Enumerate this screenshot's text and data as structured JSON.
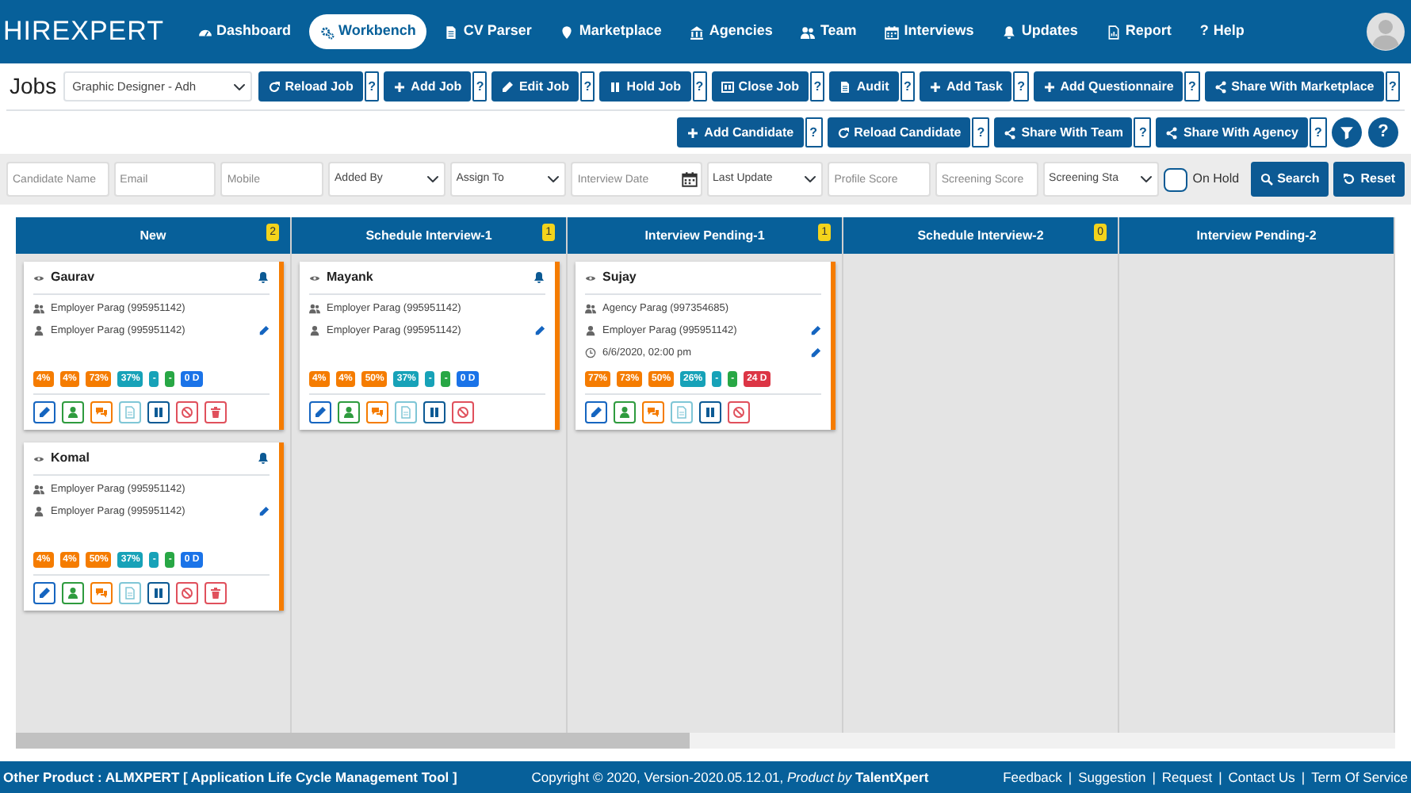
{
  "logo": "HIREXPERT",
  "nav": [
    {
      "label": "Dashboard",
      "kind": "gauge",
      "selected": false
    },
    {
      "label": "Workbench",
      "kind": "gear",
      "selected": true
    },
    {
      "label": "CV Parser",
      "kind": "document",
      "selected": false
    },
    {
      "label": "Marketplace",
      "kind": "pin",
      "selected": false
    },
    {
      "label": "Agencies",
      "kind": "bank",
      "selected": false
    },
    {
      "label": "Team",
      "kind": "users",
      "selected": false
    },
    {
      "label": "Interviews",
      "kind": "calendar",
      "selected": false
    },
    {
      "label": "Updates",
      "kind": "bell",
      "selected": false
    },
    {
      "label": "Report",
      "kind": "report",
      "selected": false
    },
    {
      "label": "Help",
      "kind": "help",
      "glyph": "?",
      "selected": false
    }
  ],
  "page_title": "Jobs",
  "job_select": {
    "value": "Graphic Designer - Adh"
  },
  "job_actions": [
    {
      "label": "Reload Job",
      "kind": "refresh",
      "help": "?"
    },
    {
      "label": "Add Job",
      "kind": "plus",
      "help": "?"
    },
    {
      "label": "Edit Job",
      "kind": "pencil",
      "help": "?"
    },
    {
      "label": "Hold Job",
      "kind": "pause",
      "help": "?"
    },
    {
      "label": "Close Job",
      "kind": "columns",
      "help": "?"
    },
    {
      "label": "Audit",
      "kind": "document",
      "help": "?"
    },
    {
      "label": "Add Task",
      "kind": "plus",
      "help": "?"
    },
    {
      "label": "Add Questionnaire",
      "kind": "plus",
      "help": "?"
    },
    {
      "label": "Share With Marketplace",
      "kind": "share",
      "help": "?"
    }
  ],
  "candidate_actions": [
    {
      "label": "Add Candidate",
      "kind": "plus",
      "help": "?"
    },
    {
      "label": "Reload Candidate",
      "kind": "refresh",
      "help": "?"
    },
    {
      "label": "Share With Team",
      "kind": "share",
      "help": "?"
    },
    {
      "label": "Share With Agency",
      "kind": "share",
      "help": "?"
    }
  ],
  "round_buttons": [
    {
      "kind": "filter"
    },
    {
      "kind": "help",
      "glyph": "?"
    }
  ],
  "filters": [
    {
      "kind": "text",
      "placeholder": "Candidate Name"
    },
    {
      "kind": "text",
      "placeholder": "Email"
    },
    {
      "kind": "text",
      "placeholder": "Mobile"
    },
    {
      "kind": "select",
      "value": "Added By"
    },
    {
      "kind": "select",
      "value": "Assign To"
    },
    {
      "kind": "date",
      "placeholder": "Interview Date"
    },
    {
      "kind": "select",
      "value": "Last Update"
    },
    {
      "kind": "text",
      "placeholder": "Profile Score"
    },
    {
      "kind": "text",
      "placeholder": "Screening Score"
    },
    {
      "kind": "select",
      "value": "Screening Sta"
    },
    {
      "kind": "checkbox",
      "label": "On Hold",
      "checked": false
    },
    {
      "kind": "search",
      "label": "Search"
    },
    {
      "kind": "reset",
      "label": "Reset"
    }
  ],
  "columns": [
    {
      "title": "New",
      "count": "2",
      "cards": [
        {
          "name": "Gaurav",
          "alert": true,
          "lines": [
            {
              "kind": "users",
              "text": "Employer Parag (995951142)",
              "editable": false
            },
            {
              "kind": "user",
              "text": "Employer Parag (995951142)",
              "editable": true
            }
          ],
          "badges": [
            {
              "text": "4%",
              "color": "#f57c00"
            },
            {
              "text": "4%",
              "color": "#f57c00"
            },
            {
              "text": "73%",
              "color": "#f57c00"
            },
            {
              "text": "37%",
              "color": "#17a2b8"
            },
            {
              "text": "-",
              "color": "#17a2b8"
            },
            {
              "text": "-",
              "color": "#28a745"
            },
            {
              "text": "0 D",
              "color": "#1a73e8"
            }
          ],
          "actions": [
            {
              "kind": "edit"
            },
            {
              "kind": "user"
            },
            {
              "kind": "comment"
            },
            {
              "kind": "file"
            },
            {
              "kind": "pause"
            },
            {
              "kind": "ban"
            },
            {
              "kind": "trash"
            }
          ]
        },
        {
          "name": "Komal",
          "alert": true,
          "lines": [
            {
              "kind": "users",
              "text": "Employer Parag (995951142)",
              "editable": false
            },
            {
              "kind": "user",
              "text": "Employer Parag (995951142)",
              "editable": true
            }
          ],
          "badges": [
            {
              "text": "4%",
              "color": "#f57c00"
            },
            {
              "text": "4%",
              "color": "#f57c00"
            },
            {
              "text": "50%",
              "color": "#f57c00"
            },
            {
              "text": "37%",
              "color": "#17a2b8"
            },
            {
              "text": "-",
              "color": "#17a2b8"
            },
            {
              "text": "-",
              "color": "#28a745"
            },
            {
              "text": "0 D",
              "color": "#1a73e8"
            }
          ],
          "actions": [
            {
              "kind": "edit"
            },
            {
              "kind": "user"
            },
            {
              "kind": "comment"
            },
            {
              "kind": "file"
            },
            {
              "kind": "pause"
            },
            {
              "kind": "ban"
            },
            {
              "kind": "trash"
            }
          ]
        }
      ]
    },
    {
      "title": "Schedule Interview-1",
      "count": "1",
      "cards": [
        {
          "name": "Mayank",
          "alert": true,
          "lines": [
            {
              "kind": "users",
              "text": "Employer Parag (995951142)",
              "editable": false
            },
            {
              "kind": "user",
              "text": "Employer Parag (995951142)",
              "editable": true
            }
          ],
          "badges": [
            {
              "text": "4%",
              "color": "#f57c00"
            },
            {
              "text": "4%",
              "color": "#f57c00"
            },
            {
              "text": "50%",
              "color": "#f57c00"
            },
            {
              "text": "37%",
              "color": "#17a2b8"
            },
            {
              "text": "-",
              "color": "#17a2b8"
            },
            {
              "text": "-",
              "color": "#28a745"
            },
            {
              "text": "0 D",
              "color": "#1a73e8"
            }
          ],
          "actions": [
            {
              "kind": "edit"
            },
            {
              "kind": "user"
            },
            {
              "kind": "comment"
            },
            {
              "kind": "file"
            },
            {
              "kind": "pause"
            },
            {
              "kind": "ban"
            }
          ]
        }
      ]
    },
    {
      "title": "Interview Pending-1",
      "count": "1",
      "cards": [
        {
          "name": "Sujay",
          "alert": false,
          "lines": [
            {
              "kind": "users",
              "text": "Agency Parag (997354685)",
              "editable": false
            },
            {
              "kind": "user",
              "text": "Employer Parag (995951142)",
              "editable": true
            },
            {
              "kind": "clock",
              "text": "6/6/2020, 02:00 pm",
              "editable": true
            }
          ],
          "badges": [
            {
              "text": "77%",
              "color": "#f57c00"
            },
            {
              "text": "73%",
              "color": "#f57c00"
            },
            {
              "text": "50%",
              "color": "#f57c00"
            },
            {
              "text": "26%",
              "color": "#17a2b8"
            },
            {
              "text": "-",
              "color": "#17a2b8"
            },
            {
              "text": "-",
              "color": "#28a745"
            },
            {
              "text": "24 D",
              "color": "#dc3545"
            }
          ],
          "actions": [
            {
              "kind": "edit"
            },
            {
              "kind": "user"
            },
            {
              "kind": "comment"
            },
            {
              "kind": "file"
            },
            {
              "kind": "pause"
            },
            {
              "kind": "ban"
            }
          ]
        }
      ]
    },
    {
      "title": "Schedule Interview-2",
      "count": "0"
    },
    {
      "title": "Interview Pending-2"
    }
  ],
  "footer": {
    "left": "Other Product : ALMXPERT [ Application Life Cycle Management Tool ]",
    "copyright": "Copyright © 2020, Version-2020.05.12.01, *Product by* **TalentXpert**",
    "separator": "|",
    "links": [
      "Feedback",
      "Suggestion",
      "Request",
      "Contact Us",
      "Term Of Service"
    ]
  }
}
